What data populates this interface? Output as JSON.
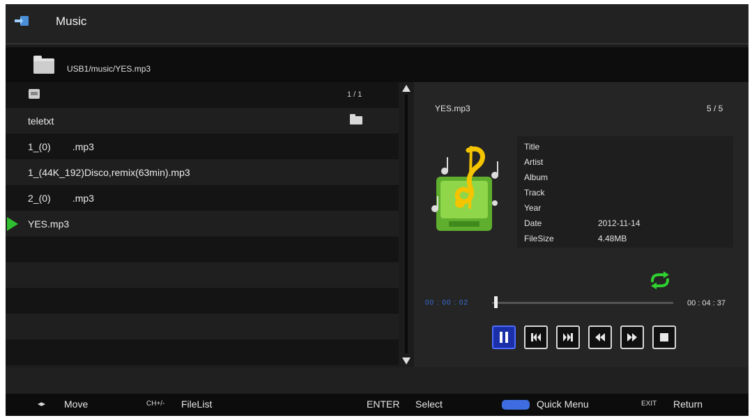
{
  "header": {
    "title": "Music",
    "icon": "music-source-icon"
  },
  "path": {
    "text": "USB1/music/YES.mp3",
    "icon": "folder-icon"
  },
  "file_list": {
    "page": "1 / 1",
    "items": [
      {
        "label": "teletxt",
        "type": "folder"
      },
      {
        "label": "1_(0)        .mp3",
        "type": "file"
      },
      {
        "label": "1_(44K_192)Disco,remix(63min).mp3",
        "type": "file"
      },
      {
        "label": "2_(0)        .mp3",
        "type": "file"
      },
      {
        "label": "YES.mp3",
        "type": "file",
        "selected": true
      }
    ]
  },
  "player": {
    "file": "YES.mp3",
    "track_count": "5 / 5",
    "info": [
      {
        "key": "Title",
        "value": ""
      },
      {
        "key": "Artist",
        "value": ""
      },
      {
        "key": "Album",
        "value": ""
      },
      {
        "key": "Track",
        "value": ""
      },
      {
        "key": "Year",
        "value": ""
      },
      {
        "key": "Date",
        "value": "2012-11-14"
      },
      {
        "key": "FileSize",
        "value": "4.48MB"
      }
    ],
    "elapsed": "00 : 00 : 02",
    "total": "00 : 04 : 37",
    "progress": 0.01,
    "controls": [
      "pause",
      "previous",
      "next",
      "rewind",
      "fast-forward",
      "stop"
    ],
    "active_control": "pause"
  },
  "footer": {
    "move_key": "◂▸",
    "move_label": "Move",
    "filelist_key": "CH+/-",
    "filelist_label": "FileList",
    "enter_key": "ENTER",
    "enter_label": "Select",
    "quick_label": "Quick Menu",
    "exit_key": "EXIT",
    "exit_label": "Return"
  },
  "colors": {
    "accent_green": "#2fbf2f",
    "accent_blue": "#3d6de0"
  }
}
